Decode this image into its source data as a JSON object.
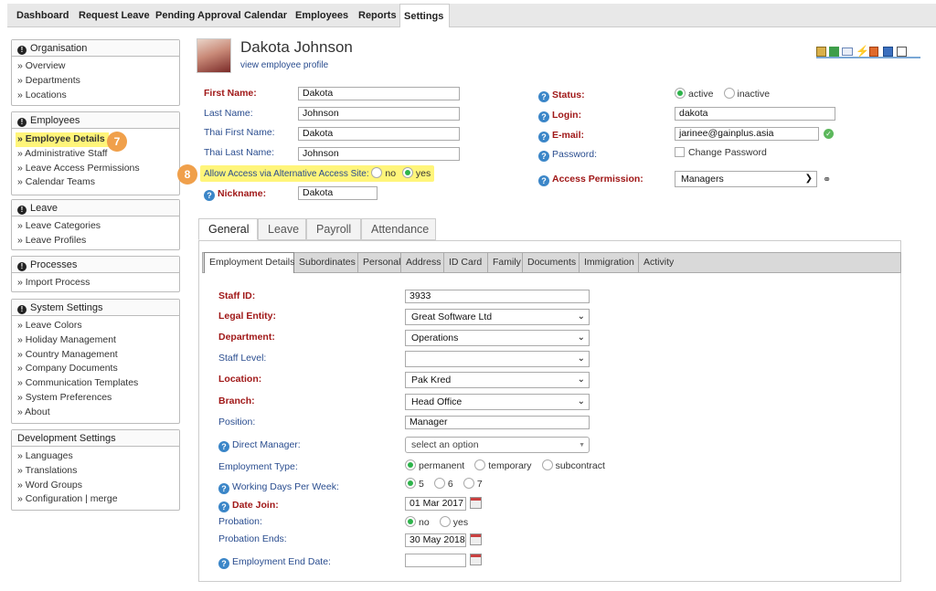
{
  "nav": {
    "items": [
      "Dashboard",
      "Request Leave",
      "Pending Approval",
      "Calendar",
      "Employees",
      "Reports",
      "Settings"
    ],
    "active": "Settings"
  },
  "sidebar": {
    "organisation": {
      "title": "Organisation",
      "items": [
        "» Overview",
        "» Departments",
        "» Locations"
      ]
    },
    "employees": {
      "title": "Employees",
      "items": [
        "» Employee Details",
        "» Administrative Staff",
        "» Leave Access Permissions",
        "» Calendar Teams"
      ]
    },
    "leave": {
      "title": "Leave",
      "items": [
        "» Leave Categories",
        "» Leave Profiles"
      ]
    },
    "processes": {
      "title": "Processes",
      "items": [
        "» Import Process"
      ]
    },
    "system": {
      "title": "System Settings",
      "items": [
        "» Leave Colors",
        "» Holiday Management",
        "» Country Management",
        "» Company Documents",
        "» Communication Templates",
        "» System Preferences",
        "» About"
      ]
    },
    "development": {
      "title": "Development Settings",
      "items": [
        "» Languages",
        "» Translations",
        "» Word Groups",
        "» Configuration | merge"
      ]
    }
  },
  "badges": {
    "b7": "7",
    "b8": "8"
  },
  "profile": {
    "name": "Dakota Johnson",
    "link": "view employee profile"
  },
  "form": {
    "first_name_label": "First Name:",
    "first_name": "Dakota",
    "last_name_label": "Last Name:",
    "last_name": "Johnson",
    "thai_first_label": "Thai First Name:",
    "thai_first": "Dakota",
    "thai_last_label": "Thai Last Name:",
    "thai_last": "Johnson",
    "alt_access_label": "Allow Access via Alternative Access Site:",
    "alt_no": "no",
    "alt_yes": "yes",
    "nickname_label": "Nickname:",
    "nickname": "Dakota",
    "status_label": "Status:",
    "status_active": "active",
    "status_inactive": "inactive",
    "login_label": "Login:",
    "login": "dakota",
    "email_label": "E-mail:",
    "email": "jarinee@gainplus.asia",
    "password_label": "Password:",
    "change_password": "Change Password",
    "access_label": "Access Permission:",
    "access": "Managers"
  },
  "tabs": [
    "General",
    "Leave",
    "Payroll",
    "Attendance"
  ],
  "subtabs": [
    "Employment Details",
    "Subordinates",
    "Personal",
    "Address",
    "ID Card",
    "Family",
    "Documents",
    "Immigration",
    "Activity"
  ],
  "employment": {
    "staff_id_label": "Staff ID:",
    "staff_id": "3933",
    "legal_entity_label": "Legal Entity:",
    "legal_entity": "Great Software Ltd",
    "department_label": "Department:",
    "department": "Operations",
    "staff_level_label": "Staff Level:",
    "staff_level": "",
    "location_label": "Location:",
    "location": "Pak Kred",
    "branch_label": "Branch:",
    "branch": "Head Office",
    "position_label": "Position:",
    "position": "Manager",
    "direct_manager_label": "Direct Manager:",
    "direct_manager": "select an option",
    "employment_type_label": "Employment Type:",
    "type_permanent": "permanent",
    "type_temporary": "temporary",
    "type_subcontract": "subcontract",
    "working_days_label": "Working Days Per Week:",
    "wd5": "5",
    "wd6": "6",
    "wd7": "7",
    "date_join_label": "Date Join:",
    "date_join": "01 Mar 2017",
    "probation_label": "Probation:",
    "prob_no": "no",
    "prob_yes": "yes",
    "probation_ends_label": "Probation Ends:",
    "probation_ends": "30 May 2018",
    "end_date_label": "Employment End Date:",
    "end_date": ""
  }
}
